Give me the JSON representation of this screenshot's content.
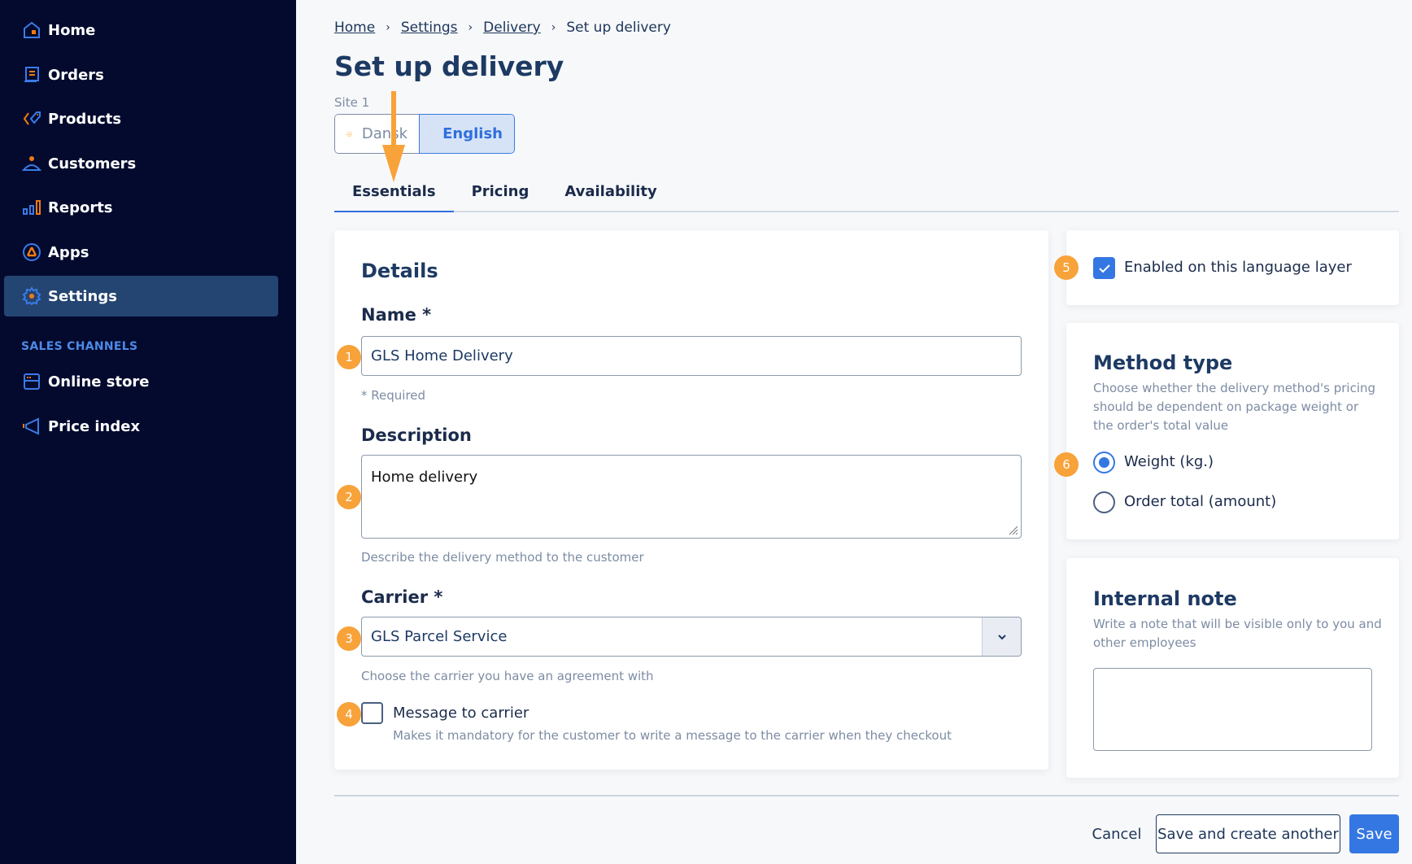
{
  "sidebar": {
    "items": [
      {
        "label": "Home",
        "icon": "home-icon"
      },
      {
        "label": "Orders",
        "icon": "orders-icon"
      },
      {
        "label": "Products",
        "icon": "tag-icon"
      },
      {
        "label": "Customers",
        "icon": "person-icon"
      },
      {
        "label": "Reports",
        "icon": "bar-chart-icon"
      },
      {
        "label": "Apps",
        "icon": "apps-icon"
      },
      {
        "label": "Settings",
        "icon": "gear-icon",
        "active": true
      }
    ],
    "section_label": "SALES CHANNELS",
    "channels": [
      {
        "label": "Online store",
        "icon": "store-icon"
      },
      {
        "label": "Price index",
        "icon": "megaphone-icon"
      }
    ]
  },
  "breadcrumb": {
    "items": [
      "Home",
      "Settings",
      "Delivery"
    ],
    "current": "Set up delivery",
    "separator": "›"
  },
  "page": {
    "title": "Set up delivery",
    "site_label": "Site 1",
    "languages": [
      {
        "label": "Dansk",
        "active": false
      },
      {
        "label": "English",
        "active": true
      }
    ]
  },
  "tabs": [
    {
      "label": "Essentials",
      "active": true
    },
    {
      "label": "Pricing",
      "active": false
    },
    {
      "label": "Availability",
      "active": false
    }
  ],
  "details": {
    "title": "Details",
    "name_label": "Name *",
    "name_value": "GLS Home Delivery",
    "required_note": "* Required",
    "description_label": "Description",
    "description_value": "Home delivery",
    "description_help": "Describe the delivery method to the customer",
    "carrier_label": "Carrier *",
    "carrier_value": "GLS Parcel Service",
    "carrier_help": "Choose the carrier you have an agreement with",
    "message_label": "Message to carrier",
    "message_help": "Makes it mandatory for the customer to write a message to the carrier when they checkout",
    "message_checked": false
  },
  "enabled": {
    "label": "Enabled on this language layer",
    "checked": true
  },
  "method_type": {
    "title": "Method type",
    "description": "Choose whether the delivery method's pricing should be dependent on package weight or the order's total value",
    "options": [
      {
        "label": "Weight (kg.)",
        "selected": true
      },
      {
        "label": "Order total (amount)",
        "selected": false
      }
    ]
  },
  "internal_note": {
    "title": "Internal note",
    "description": "Write a note that will be visible only to you and other employees",
    "value": ""
  },
  "annotations": [
    "1",
    "2",
    "3",
    "4",
    "5",
    "6"
  ],
  "footer": {
    "cancel": "Cancel",
    "save_another": "Save and create another",
    "save": "Save"
  },
  "colors": {
    "sidebar_bg": "#030a2e",
    "sidebar_active": "#244572",
    "accent": "#3477e3",
    "annotation": "#f8a23a",
    "icon_orange": "#f07b12"
  }
}
